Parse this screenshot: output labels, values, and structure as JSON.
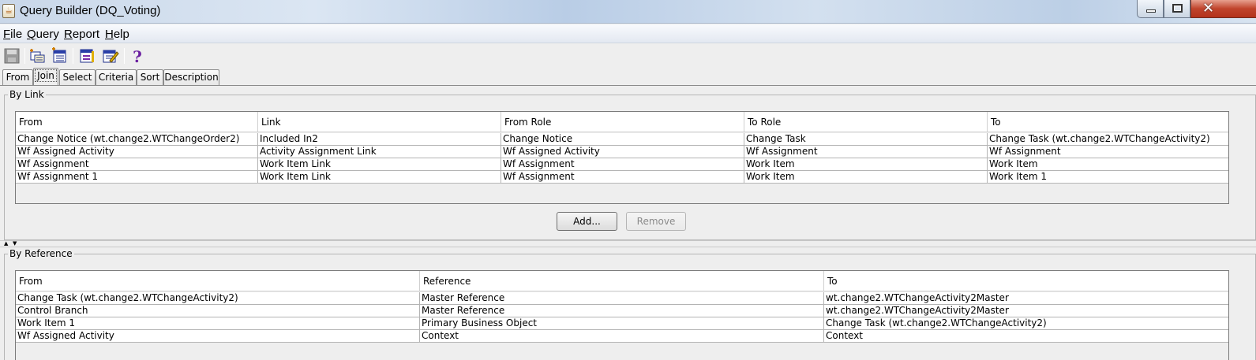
{
  "window": {
    "title": "Query Builder (DQ_Voting)",
    "app_icon": "java-cup-icon"
  },
  "menu": [
    {
      "label": "File",
      "mnemonic": "F",
      "rest": "ile"
    },
    {
      "label": "Query",
      "mnemonic": "Q",
      "rest": "uery"
    },
    {
      "label": "Report",
      "mnemonic": "R",
      "rest": "eport"
    },
    {
      "label": "Help",
      "mnemonic": "H",
      "rest": "elp"
    }
  ],
  "toolbar": {
    "icons": [
      "save-icon",
      "add-class-icon",
      "add-attribute-icon",
      "report-icon",
      "edit-report-icon",
      "help-icon"
    ]
  },
  "tabs": [
    {
      "label": "From",
      "active": false
    },
    {
      "label": "Join",
      "active": true
    },
    {
      "label": "Select",
      "active": false
    },
    {
      "label": "Criteria",
      "active": false
    },
    {
      "label": "Sort",
      "active": false
    },
    {
      "label": "Description",
      "active": false
    }
  ],
  "by_link": {
    "title": "By Link",
    "columns": [
      "From",
      "Link",
      "From Role",
      "To Role",
      "To"
    ],
    "rows": [
      [
        "Change Notice (wt.change2.WTChangeOrder2)",
        "Included In2",
        "Change Notice",
        "Change Task",
        "Change Task (wt.change2.WTChangeActivity2)"
      ],
      [
        "Wf Assigned Activity",
        "Activity Assignment Link",
        "Wf Assigned Activity",
        "Wf Assignment",
        "Wf Assignment"
      ],
      [
        "Wf Assignment",
        "Work Item Link",
        "Wf Assignment",
        "Work Item",
        "Work Item"
      ],
      [
        "Wf Assignment 1",
        "Work Item Link",
        "Wf Assignment",
        "Work Item",
        "Work Item 1"
      ]
    ],
    "add_label": "Add...",
    "remove_label": "Remove"
  },
  "by_reference": {
    "title": "By Reference",
    "columns": [
      "From",
      "Reference",
      "To"
    ],
    "rows": [
      [
        "Change Task (wt.change2.WTChangeActivity2)",
        "Master Reference",
        "wt.change2.WTChangeActivity2Master"
      ],
      [
        "Control Branch",
        "Master Reference",
        "wt.change2.WTChangeActivity2Master"
      ],
      [
        "Work Item 1",
        "Primary Business Object",
        "Change Task (wt.change2.WTChangeActivity2)"
      ],
      [
        "Wf Assigned Activity",
        "Context",
        "Context"
      ]
    ]
  }
}
